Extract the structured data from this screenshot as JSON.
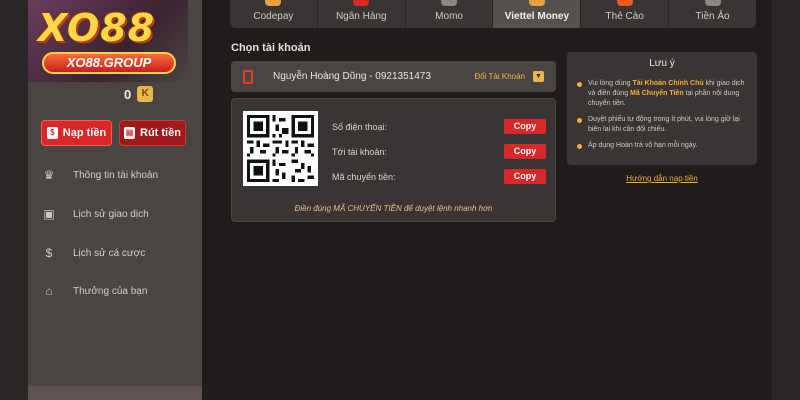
{
  "brand": {
    "logo_text": "XO88",
    "logo_subtext": "XO88.GROUP"
  },
  "balance": {
    "value": "0",
    "coin_label": "K"
  },
  "actions": {
    "deposit": "Nạp tiền",
    "withdraw": "Rút tiền"
  },
  "nav": [
    {
      "label": "Thông tin tài khoản",
      "icon": "crown-icon"
    },
    {
      "label": "Lịch sử giao dịch",
      "icon": "wallet-icon"
    },
    {
      "label": "Lịch sử cá cược",
      "icon": "money-bag-icon"
    },
    {
      "label": "Thưởng của bạn",
      "icon": "gift-icon"
    }
  ],
  "tabs": [
    {
      "label": "Codepay",
      "color": "#e8a040"
    },
    {
      "label": "Ngân Hàng",
      "color": "#d8282a"
    },
    {
      "label": "Momo",
      "color": "#888888"
    },
    {
      "label": "Viettel Money",
      "color": "#e8a040",
      "active": true
    },
    {
      "label": "Thẻ Cào",
      "color": "#e85a20"
    },
    {
      "label": "Tiền Ảo",
      "color": "#888888"
    }
  ],
  "account": {
    "section_title": "Chọn tài khoản",
    "name": "Nguyễn Hoàng Dũng - 0921351473",
    "switch_label": "Đổi Tài Khoản"
  },
  "transfer": {
    "rows": [
      {
        "label": "Số điện thoại:",
        "button": "Copy"
      },
      {
        "label": "Tới tài khoản:",
        "button": "Copy"
      },
      {
        "label": "Mã chuyển tiền:",
        "button": "Copy"
      }
    ],
    "note": "Điền đúng MÃ CHUYỂN TIỀN để duyệt lệnh nhanh hơn"
  },
  "notice": {
    "title": "Lưu ý",
    "item1_pre": "Vui lòng dùng ",
    "item1_hl1": "Tài Khoản Chính Chủ",
    "item1_mid": " khi giao dịch và điền đúng ",
    "item1_hl2": "Mã Chuyển Tiền",
    "item1_post": " tại phần nội dung chuyển tiền.",
    "item2": "Duyệt phiếu tự động trong ít phút, vui lòng giữ lại biên lai khi cần đối chiếu.",
    "item3": "Áp dụng Hoàn trả vô hạn mỗi ngày.",
    "guide_link": "Hướng dẫn nạp tiền"
  }
}
